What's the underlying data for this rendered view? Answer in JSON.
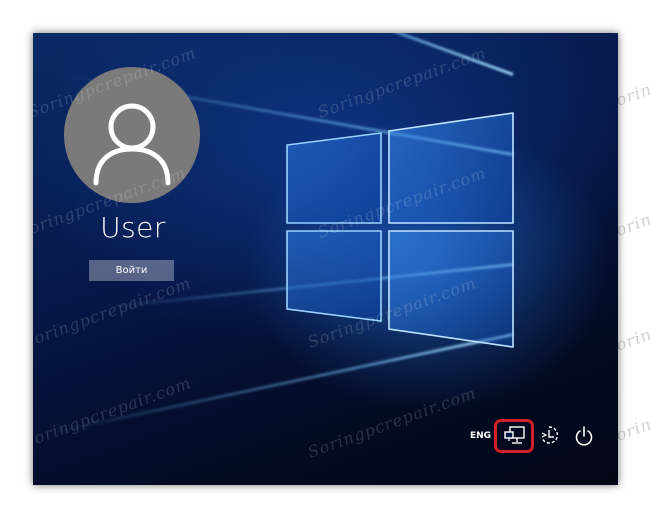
{
  "login": {
    "username": "User",
    "signin_label": "Войти"
  },
  "tray": {
    "language": "ENG",
    "icons": [
      "network-icon",
      "ease-of-access-icon",
      "power-icon"
    ]
  },
  "watermark": "Soringpcrepair.com",
  "colors": {
    "highlight": "#d2202a",
    "avatar_bg": "#7a7a7a",
    "background": "#06184a"
  }
}
